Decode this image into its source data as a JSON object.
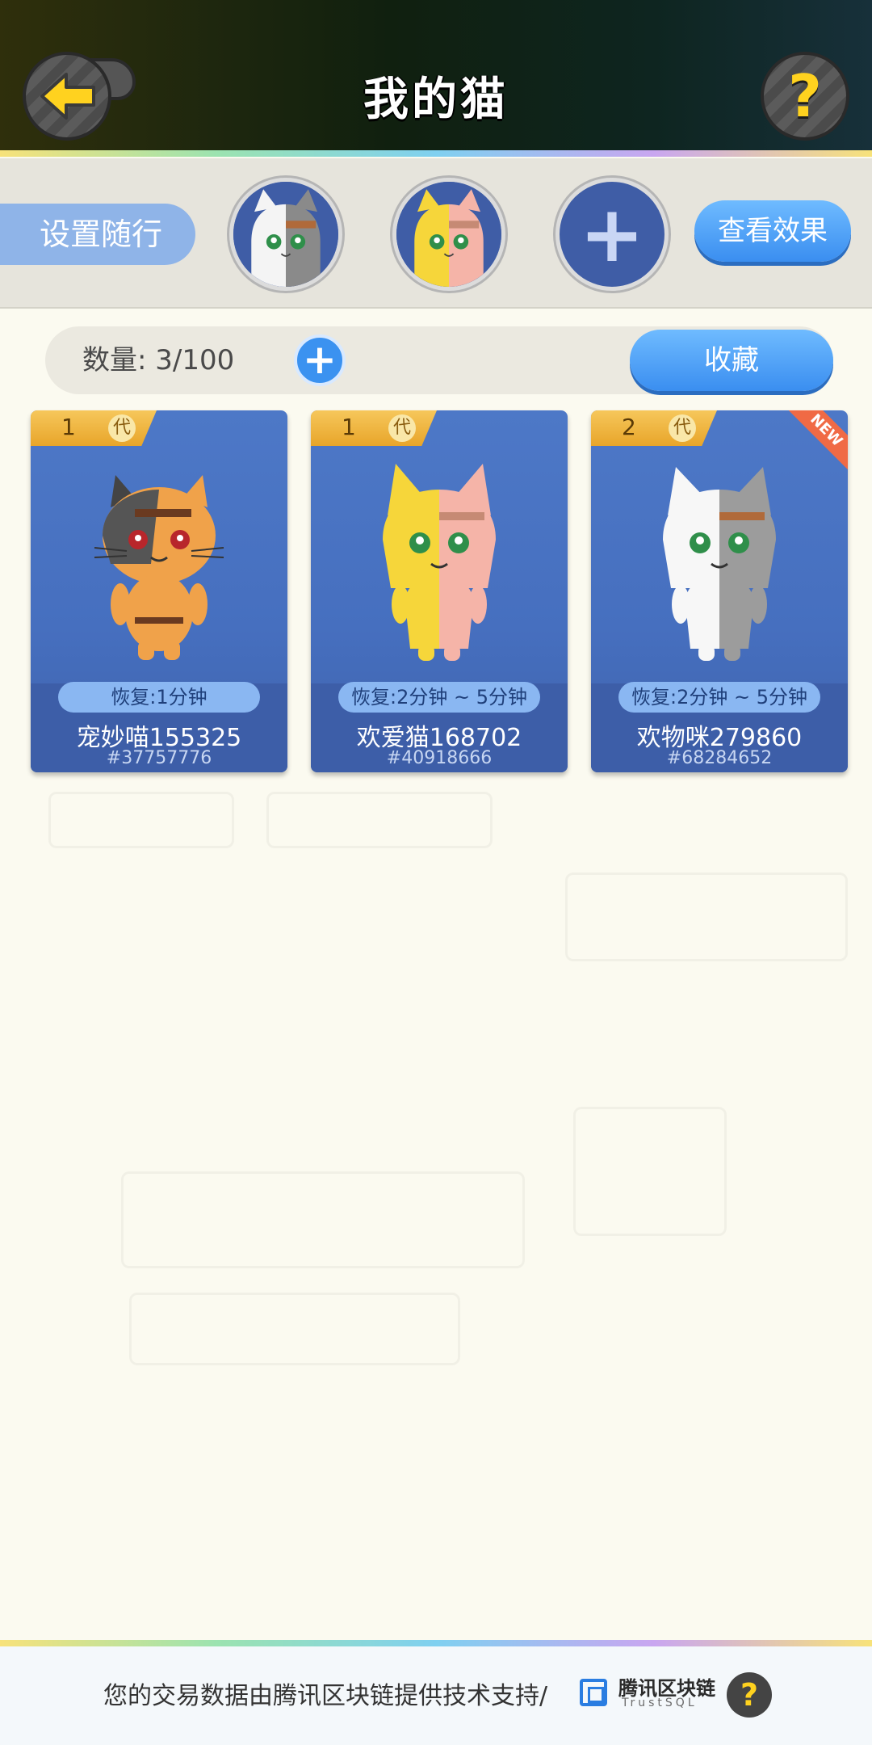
{
  "header": {
    "title": "我的猫",
    "back_icon": "back-arrow-icon",
    "help_icon_text": "?"
  },
  "follow": {
    "label": "设置随行",
    "slots": [
      {
        "cat": "white-gray-cat"
      },
      {
        "cat": "yellow-pink-cat"
      },
      {
        "add_text": "+"
      }
    ],
    "view_button": "查看效果"
  },
  "inventory": {
    "count_label": "数量: 3/100",
    "add_text": "+",
    "favorites_button": "收藏"
  },
  "cards": [
    {
      "gen_num": "1",
      "gen_label": "代",
      "is_new": false,
      "recover": "恢复:1分钟",
      "name": "宠妙喵155325",
      "id": "#37757776",
      "colors": {
        "left": "#f0a24a",
        "right": "#f0a24a",
        "accent": "#555555"
      }
    },
    {
      "gen_num": "1",
      "gen_label": "代",
      "is_new": false,
      "recover": "恢复:2分钟 ~ 5分钟",
      "name": "欢爱猫168702",
      "id": "#40918666",
      "colors": {
        "left": "#f6d63a",
        "right": "#f5b4a8",
        "accent": "#b07a3a"
      }
    },
    {
      "gen_num": "2",
      "gen_label": "代",
      "is_new": true,
      "new_text": "NEW",
      "recover": "恢复:2分钟 ~ 5分钟",
      "name": "欢物咪279860",
      "id": "#68284652",
      "colors": {
        "left": "#f7f7f7",
        "right": "#9c9c9c",
        "accent": "#b06a3a"
      }
    }
  ],
  "footer": {
    "text": "您的交易数据由腾讯区块链提供技术支持/",
    "brand": "腾讯区块链",
    "brand_sub": "TrustSQL",
    "help_icon_text": "?"
  }
}
